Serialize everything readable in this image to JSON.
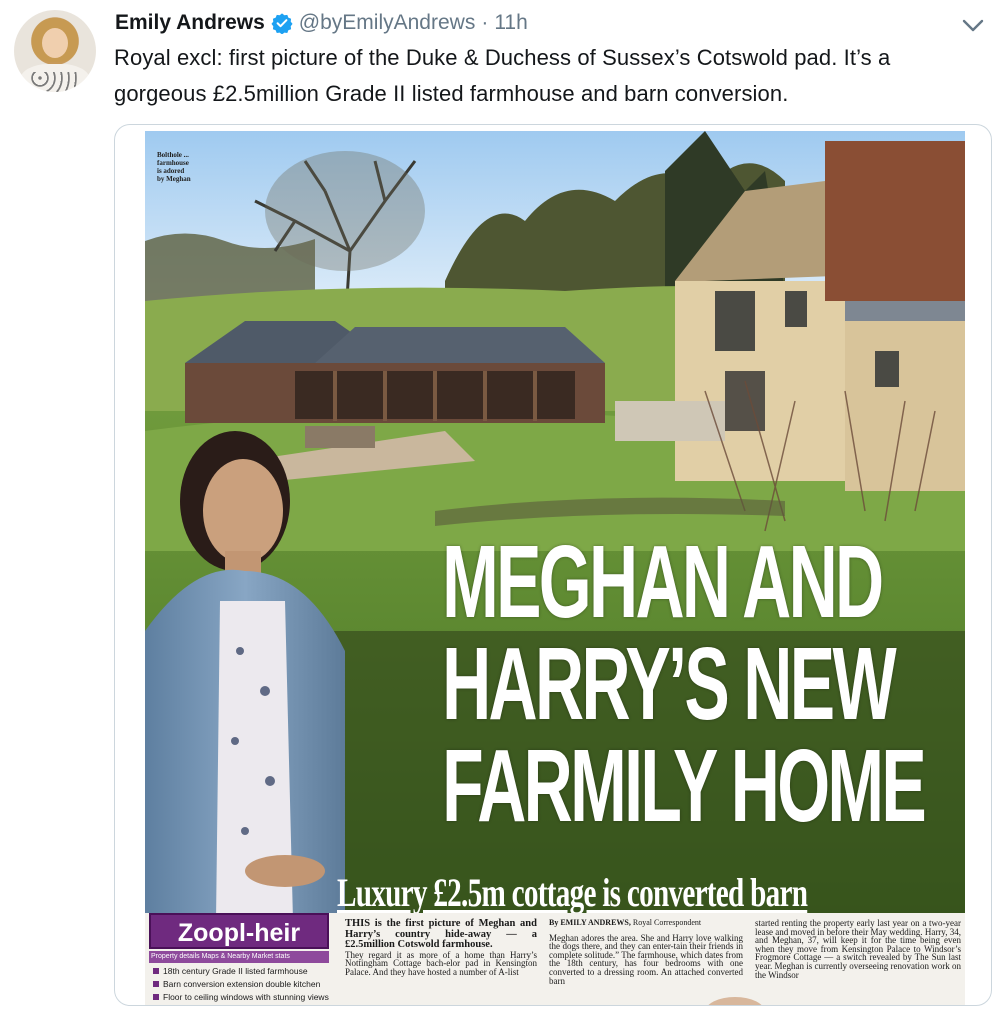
{
  "tweet": {
    "display_name": "Emily Andrews",
    "handle": "@byEmilyAndrews",
    "separator": "·",
    "time": "11h",
    "text_line1": "Royal excl: first picture of the Duke & Duchess of Sussex’s Cotswold pad. It’s a",
    "text_line2": "gorgeous £2.5million Grade II listed farmhouse and barn conversion.",
    "icons": {
      "verified": "verified-badge-icon",
      "menu": "chevron-down-icon"
    },
    "colors": {
      "verified": "#1da1f2",
      "secondary_text": "#657786",
      "border": "#ccd6dd"
    }
  },
  "newspaper": {
    "photo_caption": [
      "Bolthole ...",
      "farmhouse",
      "is adored",
      "by Meghan"
    ],
    "headline": [
      "MEGHAN AND",
      "HARRY’S NEW",
      "FARMILY HOME"
    ],
    "subhead": "Luxury £2.5m cottage is converted barn",
    "zoopla": {
      "logo": "Zoopl-heir",
      "tabs": "Property details  Maps & Nearby  Market stats",
      "items": [
        "18th century Grade II listed farmhouse",
        "Barn conversion extension double kitchen",
        "Floor to ceiling windows with stunning views"
      ]
    },
    "col1_lead": "THIS is the first picture of Meghan and Harry’s country hide-away — a £2.5million Cotswold farmhouse.",
    "col1_body": "They regard it as more of a home than Harry’s Nottingham Cottage bach-elor pad in Kensington Palace. And they have hosted a number of A-list",
    "col2_byline": "By EMILY ANDREWS,",
    "col2_byline_role": "Royal Correspondent",
    "col2_body": "Meghan adores the area. She and Harry love walking the dogs there, and they can enter-tain their friends in complete solitude.” The farmhouse, which dates from the 18th century, has four bedrooms with one converted to a dressing room. An attached converted barn",
    "col3_body": "started renting the property early last year on a two-year lease and moved in before their May wedding. Harry, 34, and Meghan, 37, will keep it for the time being even when they move from Kensington Palace to Windsor’s Frogmore Cottage — a switch revealed by The Sun last year. Meghan is currently overseeing renovation work on the Windsor"
  }
}
